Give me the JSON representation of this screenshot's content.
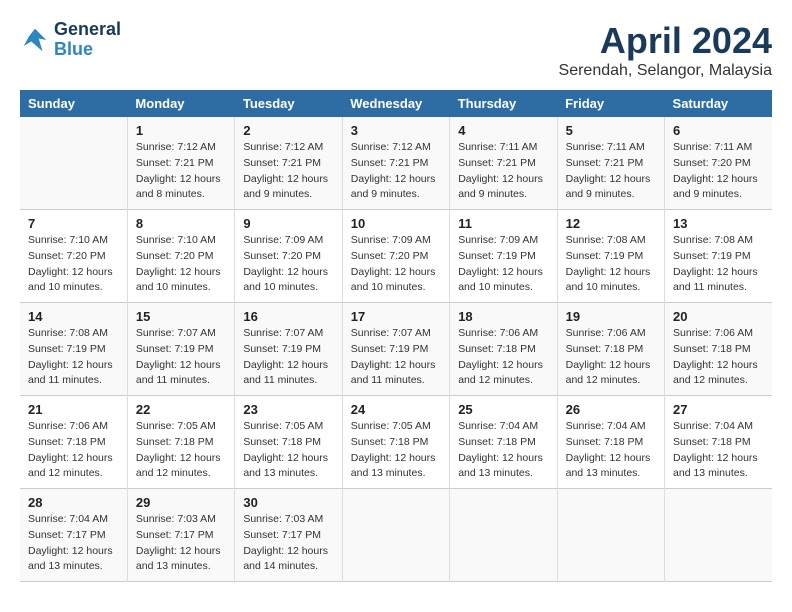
{
  "header": {
    "logo_line1": "General",
    "logo_line2": "Blue",
    "month": "April 2024",
    "location": "Serendah, Selangor, Malaysia"
  },
  "days_of_week": [
    "Sunday",
    "Monday",
    "Tuesday",
    "Wednesday",
    "Thursday",
    "Friday",
    "Saturday"
  ],
  "weeks": [
    [
      {
        "day": "",
        "info": ""
      },
      {
        "day": "1",
        "info": "Sunrise: 7:12 AM\nSunset: 7:21 PM\nDaylight: 12 hours\nand 8 minutes."
      },
      {
        "day": "2",
        "info": "Sunrise: 7:12 AM\nSunset: 7:21 PM\nDaylight: 12 hours\nand 9 minutes."
      },
      {
        "day": "3",
        "info": "Sunrise: 7:12 AM\nSunset: 7:21 PM\nDaylight: 12 hours\nand 9 minutes."
      },
      {
        "day": "4",
        "info": "Sunrise: 7:11 AM\nSunset: 7:21 PM\nDaylight: 12 hours\nand 9 minutes."
      },
      {
        "day": "5",
        "info": "Sunrise: 7:11 AM\nSunset: 7:21 PM\nDaylight: 12 hours\nand 9 minutes."
      },
      {
        "day": "6",
        "info": "Sunrise: 7:11 AM\nSunset: 7:20 PM\nDaylight: 12 hours\nand 9 minutes."
      }
    ],
    [
      {
        "day": "7",
        "info": "Sunrise: 7:10 AM\nSunset: 7:20 PM\nDaylight: 12 hours\nand 10 minutes."
      },
      {
        "day": "8",
        "info": "Sunrise: 7:10 AM\nSunset: 7:20 PM\nDaylight: 12 hours\nand 10 minutes."
      },
      {
        "day": "9",
        "info": "Sunrise: 7:09 AM\nSunset: 7:20 PM\nDaylight: 12 hours\nand 10 minutes."
      },
      {
        "day": "10",
        "info": "Sunrise: 7:09 AM\nSunset: 7:20 PM\nDaylight: 12 hours\nand 10 minutes."
      },
      {
        "day": "11",
        "info": "Sunrise: 7:09 AM\nSunset: 7:19 PM\nDaylight: 12 hours\nand 10 minutes."
      },
      {
        "day": "12",
        "info": "Sunrise: 7:08 AM\nSunset: 7:19 PM\nDaylight: 12 hours\nand 10 minutes."
      },
      {
        "day": "13",
        "info": "Sunrise: 7:08 AM\nSunset: 7:19 PM\nDaylight: 12 hours\nand 11 minutes."
      }
    ],
    [
      {
        "day": "14",
        "info": "Sunrise: 7:08 AM\nSunset: 7:19 PM\nDaylight: 12 hours\nand 11 minutes."
      },
      {
        "day": "15",
        "info": "Sunrise: 7:07 AM\nSunset: 7:19 PM\nDaylight: 12 hours\nand 11 minutes."
      },
      {
        "day": "16",
        "info": "Sunrise: 7:07 AM\nSunset: 7:19 PM\nDaylight: 12 hours\nand 11 minutes."
      },
      {
        "day": "17",
        "info": "Sunrise: 7:07 AM\nSunset: 7:19 PM\nDaylight: 12 hours\nand 11 minutes."
      },
      {
        "day": "18",
        "info": "Sunrise: 7:06 AM\nSunset: 7:18 PM\nDaylight: 12 hours\nand 12 minutes."
      },
      {
        "day": "19",
        "info": "Sunrise: 7:06 AM\nSunset: 7:18 PM\nDaylight: 12 hours\nand 12 minutes."
      },
      {
        "day": "20",
        "info": "Sunrise: 7:06 AM\nSunset: 7:18 PM\nDaylight: 12 hours\nand 12 minutes."
      }
    ],
    [
      {
        "day": "21",
        "info": "Sunrise: 7:06 AM\nSunset: 7:18 PM\nDaylight: 12 hours\nand 12 minutes."
      },
      {
        "day": "22",
        "info": "Sunrise: 7:05 AM\nSunset: 7:18 PM\nDaylight: 12 hours\nand 12 minutes."
      },
      {
        "day": "23",
        "info": "Sunrise: 7:05 AM\nSunset: 7:18 PM\nDaylight: 12 hours\nand 13 minutes."
      },
      {
        "day": "24",
        "info": "Sunrise: 7:05 AM\nSunset: 7:18 PM\nDaylight: 12 hours\nand 13 minutes."
      },
      {
        "day": "25",
        "info": "Sunrise: 7:04 AM\nSunset: 7:18 PM\nDaylight: 12 hours\nand 13 minutes."
      },
      {
        "day": "26",
        "info": "Sunrise: 7:04 AM\nSunset: 7:18 PM\nDaylight: 12 hours\nand 13 minutes."
      },
      {
        "day": "27",
        "info": "Sunrise: 7:04 AM\nSunset: 7:18 PM\nDaylight: 12 hours\nand 13 minutes."
      }
    ],
    [
      {
        "day": "28",
        "info": "Sunrise: 7:04 AM\nSunset: 7:17 PM\nDaylight: 12 hours\nand 13 minutes."
      },
      {
        "day": "29",
        "info": "Sunrise: 7:03 AM\nSunset: 7:17 PM\nDaylight: 12 hours\nand 13 minutes."
      },
      {
        "day": "30",
        "info": "Sunrise: 7:03 AM\nSunset: 7:17 PM\nDaylight: 12 hours\nand 14 minutes."
      },
      {
        "day": "",
        "info": ""
      },
      {
        "day": "",
        "info": ""
      },
      {
        "day": "",
        "info": ""
      },
      {
        "day": "",
        "info": ""
      }
    ]
  ]
}
